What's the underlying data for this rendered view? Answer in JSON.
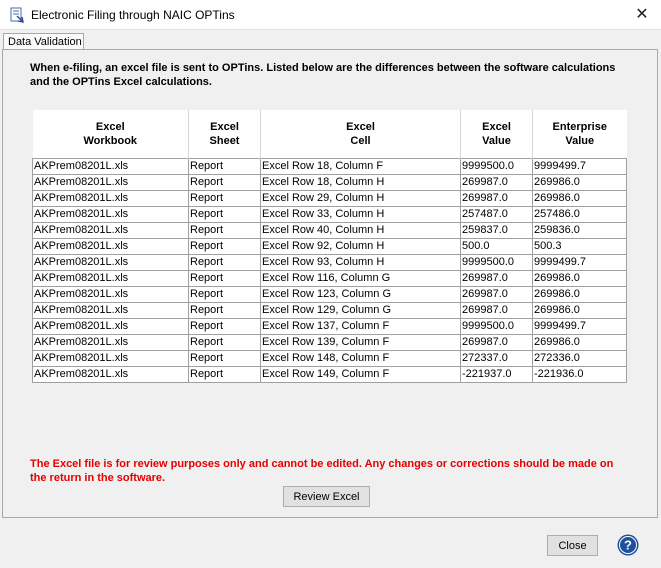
{
  "window": {
    "title": "Electronic Filing through NAIC OPTins",
    "close_glyph": "✕"
  },
  "tab": {
    "label": "Data Validation"
  },
  "intro_text": "When e-filing, an excel file is sent to OPTins. Listed below are the differences between the software calculations and the OPTins Excel calculations.",
  "table": {
    "headers": [
      [
        "Excel",
        "Workbook"
      ],
      [
        "Excel",
        "Sheet"
      ],
      [
        "Excel",
        "Cell"
      ],
      [
        "Excel",
        "Value"
      ],
      [
        "Enterprise",
        "Value"
      ]
    ],
    "rows": [
      [
        "AKPrem08201L.xls",
        "Report",
        "Excel Row 18, Column F",
        "9999500.0",
        "9999499.7"
      ],
      [
        "AKPrem08201L.xls",
        "Report",
        "Excel Row 18, Column H",
        "269987.0",
        "269986.0"
      ],
      [
        "AKPrem08201L.xls",
        "Report",
        "Excel Row 29, Column H",
        "269987.0",
        "269986.0"
      ],
      [
        "AKPrem08201L.xls",
        "Report",
        "Excel Row 33, Column H",
        "257487.0",
        "257486.0"
      ],
      [
        "AKPrem08201L.xls",
        "Report",
        "Excel Row 40, Column H",
        "259837.0",
        "259836.0"
      ],
      [
        "AKPrem08201L.xls",
        "Report",
        "Excel Row 92, Column H",
        "500.0",
        "500.3"
      ],
      [
        "AKPrem08201L.xls",
        "Report",
        "Excel Row 93, Column H",
        "9999500.0",
        "9999499.7"
      ],
      [
        "AKPrem08201L.xls",
        "Report",
        "Excel Row 116, Column G",
        "269987.0",
        "269986.0"
      ],
      [
        "AKPrem08201L.xls",
        "Report",
        "Excel Row 123, Column G",
        "269987.0",
        "269986.0"
      ],
      [
        "AKPrem08201L.xls",
        "Report",
        "Excel Row 129, Column G",
        "269987.0",
        "269986.0"
      ],
      [
        "AKPrem08201L.xls",
        "Report",
        "Excel Row 137, Column F",
        "9999500.0",
        "9999499.7"
      ],
      [
        "AKPrem08201L.xls",
        "Report",
        "Excel Row 139, Column F",
        "269987.0",
        "269986.0"
      ],
      [
        "AKPrem08201L.xls",
        "Report",
        "Excel Row 148, Column F",
        "272337.0",
        "272336.0"
      ],
      [
        "AKPrem08201L.xls",
        "Report",
        "Excel Row 149, Column F",
        "-221937.0",
        "-221936.0"
      ]
    ]
  },
  "note_text": "The Excel file is for review purposes only and cannot be edited. Any changes or corrections should be made on the return in the software.",
  "buttons": {
    "review_excel": "Review Excel",
    "close": "Close"
  },
  "help_glyph": "?",
  "colors": {
    "note_red": "#e60000",
    "help_blue": "#1f4e9a"
  }
}
